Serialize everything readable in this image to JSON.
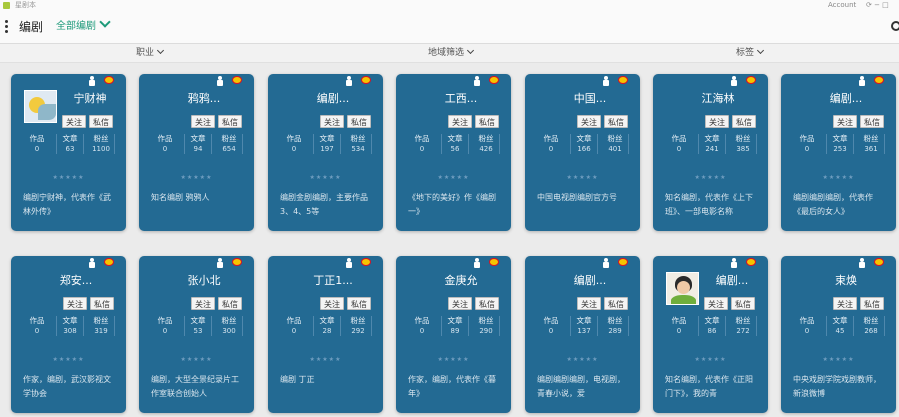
{
  "window": {
    "title": "星剧本",
    "minimize": "Account",
    "controls": "⟳ − □"
  },
  "header": {
    "title": "编剧",
    "dropdown": "全部编剧"
  },
  "filters": [
    "职业",
    "地域筛选",
    "标签"
  ],
  "labels": {
    "follow": "关注",
    "message": "私信",
    "works": "作品",
    "articles": "文章",
    "fans": "粉丝",
    "stars": "★★★★★"
  },
  "cards": [
    {
      "name": "宁财神",
      "gender": "male",
      "avatar": "landscape",
      "works": "0",
      "articles": "63",
      "fans": "1100",
      "bio": "编剧宁财神，代表作《武林外传》"
    },
    {
      "name": "鸦鸦...",
      "gender": "male",
      "avatar": "",
      "works": "0",
      "articles": "94",
      "fans": "654",
      "bio": "知名编剧 鸦鸦人"
    },
    {
      "name": "编剧...",
      "gender": "male",
      "avatar": "",
      "works": "0",
      "articles": "197",
      "fans": "534",
      "bio": "编剧金剧编剧，主要作品3、4、5等"
    },
    {
      "name": "工西...",
      "gender": "male",
      "avatar": "",
      "works": "0",
      "articles": "56",
      "fans": "426",
      "bio": "《地下的美好》作《编剧一》"
    },
    {
      "name": "中国...",
      "gender": "male",
      "avatar": "",
      "works": "0",
      "articles": "166",
      "fans": "401",
      "bio": "中国电视剧编剧官方号"
    },
    {
      "name": "江海林",
      "gender": "male",
      "avatar": "",
      "works": "0",
      "articles": "241",
      "fans": "385",
      "bio": "知名编剧，代表作《上下班》、一部电影名称"
    },
    {
      "name": "编剧...",
      "gender": "male",
      "avatar": "",
      "works": "0",
      "articles": "253",
      "fans": "361",
      "bio": "编剧编剧编剧，代表作《最后的女人》"
    },
    {
      "name": "郑安...",
      "gender": "male",
      "avatar": "",
      "works": "0",
      "articles": "308",
      "fans": "319",
      "bio": "作家，编剧，武汉影视文学协会"
    },
    {
      "name": "张小北",
      "gender": "male",
      "avatar": "",
      "works": "0",
      "articles": "53",
      "fans": "300",
      "bio": "编剧，大型全景纪录片工作室联合创始人"
    },
    {
      "name": "丁正1...",
      "gender": "male",
      "avatar": "",
      "works": "0",
      "articles": "28",
      "fans": "292",
      "bio": "编剧 丁正"
    },
    {
      "name": "金庚允",
      "gender": "male",
      "avatar": "",
      "works": "0",
      "articles": "89",
      "fans": "290",
      "bio": "作家，编剧，代表作《暮年》"
    },
    {
      "name": "编剧...",
      "gender": "male",
      "avatar": "",
      "works": "0",
      "articles": "137",
      "fans": "289",
      "bio": "编剧编剧编剧，电视剧，青春小说，爱"
    },
    {
      "name": "编剧...",
      "gender": "male",
      "avatar": "person",
      "works": "0",
      "articles": "86",
      "fans": "272",
      "bio": "知名编剧，代表作《正阳门下》，我的青"
    },
    {
      "name": "束焕",
      "gender": "male",
      "avatar": "",
      "works": "0",
      "articles": "45",
      "fans": "268",
      "bio": "中央戏剧学院戏剧教师，新浪微博"
    }
  ]
}
